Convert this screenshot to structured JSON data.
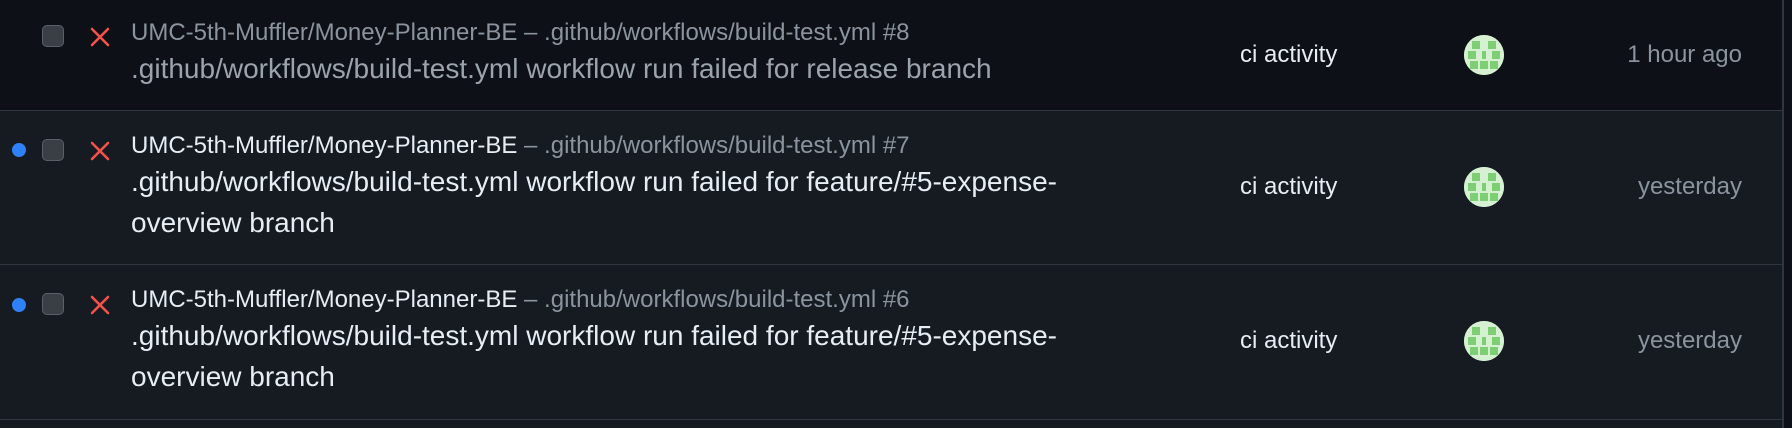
{
  "notifications": [
    {
      "unread": false,
      "status_icon": "x-icon",
      "repo": "UMC-5th-Muffler/Money-Planner-BE",
      "separator": "–",
      "workflow": ".github/workflows/build-test.yml #8",
      "title": ".github/workflows/build-test.yml workflow run failed for release branch",
      "reason": "ci activity",
      "time": "1 hour ago"
    },
    {
      "unread": true,
      "status_icon": "x-icon",
      "repo": "UMC-5th-Muffler/Money-Planner-BE",
      "separator": "–",
      "workflow": ".github/workflows/build-test.yml #7",
      "title": ".github/workflows/build-test.yml workflow run failed for feature/#5-expense-overview branch",
      "reason": "ci activity",
      "time": "yesterday"
    },
    {
      "unread": true,
      "status_icon": "x-icon",
      "repo": "UMC-5th-Muffler/Money-Planner-BE",
      "separator": "–",
      "workflow": ".github/workflows/build-test.yml #6",
      "title": ".github/workflows/build-test.yml workflow run failed for feature/#5-expense-overview branch",
      "reason": "ci activity",
      "time": "yesterday"
    }
  ],
  "colors": {
    "unread_dot": "#2f81f7",
    "failure_x": "#f85149",
    "avatar_green": "#7ccf72"
  }
}
